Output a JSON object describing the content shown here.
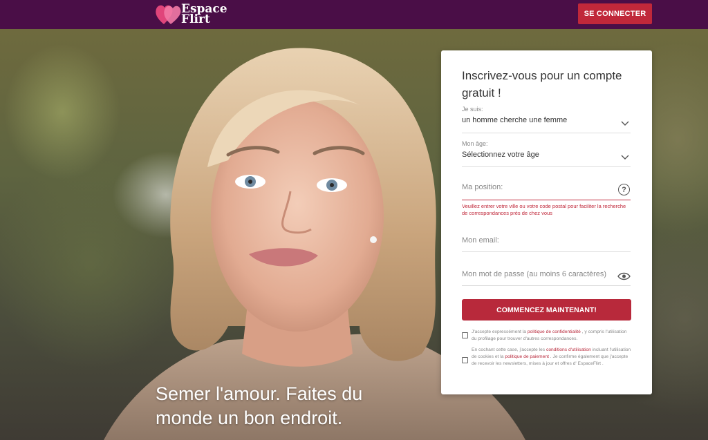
{
  "brand": {
    "line1": "Espace",
    "line2": "Flirt"
  },
  "header": {
    "login_label": "SE CONNECTER"
  },
  "hero": {
    "tagline": "Semer l'amour. Faites du monde un bon endroit."
  },
  "form": {
    "title": "Inscrivez-vous pour un compte gratuit !",
    "iam": {
      "label": "Je suis:",
      "value": "un homme cherche une femme"
    },
    "age": {
      "label": "Mon âge:",
      "value": "Sélectionnez votre âge"
    },
    "position": {
      "placeholder": "Ma position:",
      "error": "Veuillez entrer votre ville ou votre code postal pour faciliter la recherche de correspondances près de chez vous"
    },
    "email": {
      "placeholder": "Mon email:"
    },
    "password": {
      "placeholder": "Mon mot de passe (au moins 6 caractères)"
    },
    "cta_label": "COMMENCEZ MAINTENANT!",
    "consent1": {
      "text_a": "J'accepte expressément la",
      "link": "politique de confidentialité",
      "text_b": ", y compris l'utilisation du profilage pour trouver d'autres correspondances."
    },
    "consent2": {
      "text_a": "En cochant cette case, j'accepte les",
      "link_a": "conditions d'utilisation",
      "text_b": "incluant l'utilisation de cookies et la",
      "link_b": "politique de paiement",
      "text_c": ". Je confirme également que j'accepte de recevoir les newsletters, mises à jour et offres d' EspaceFlirt ."
    }
  },
  "colors": {
    "header_bg": "#4a0e47",
    "accent": "#c0283a",
    "error": "#c0283a"
  }
}
